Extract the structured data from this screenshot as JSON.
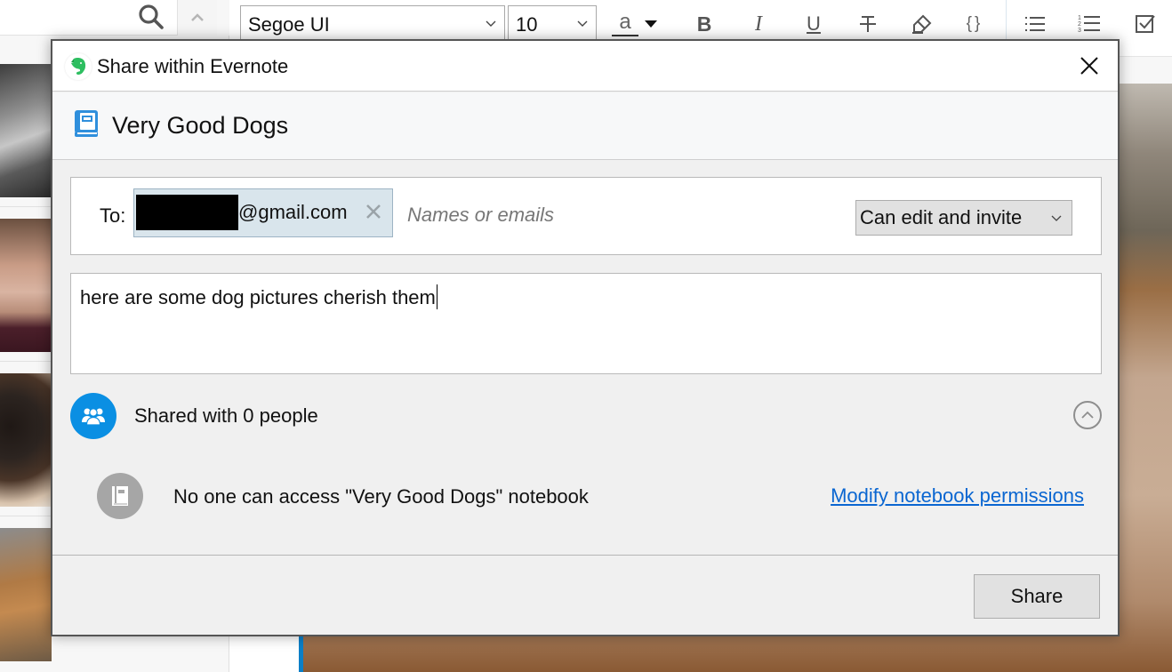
{
  "background_app": {
    "toolbar": {
      "font_family_value": "Segoe UI",
      "font_size_value": "10",
      "buttons": [
        {
          "name": "font-color",
          "glyph": "a"
        },
        {
          "name": "font-color-dropdown",
          "glyph": "▼"
        },
        {
          "name": "bold",
          "glyph": "B"
        },
        {
          "name": "italic",
          "glyph": "I"
        },
        {
          "name": "underline",
          "glyph": "U"
        },
        {
          "name": "strikethrough",
          "glyph": "T"
        },
        {
          "name": "highlight",
          "glyph": "highlighter"
        },
        {
          "name": "code-block",
          "glyph": "{ }"
        },
        {
          "name": "bulleted-list",
          "glyph": "bullet-list"
        },
        {
          "name": "numbered-list",
          "glyph": "numbered-list"
        },
        {
          "name": "checklist",
          "glyph": "checkbox"
        }
      ]
    },
    "accent_color": "#0a7fc7"
  },
  "dialog": {
    "title": "Share within Evernote",
    "notebook_name": "Very Good Dogs",
    "to_label": "To:",
    "recipient": {
      "email_visible_part": "@gmail.com",
      "redacted": true
    },
    "to_input_placeholder": "Names or emails",
    "permission": {
      "selected": "Can edit and invite"
    },
    "message": "here are some dog pictures cherish them",
    "shared_with_text": "Shared with 0 people",
    "access_text": "No one can access \"Very Good Dogs\" notebook",
    "modify_link": "Modify notebook permissions",
    "share_button": "Share",
    "colors": {
      "logo_green": "#2dbe60",
      "notebook_blue": "#2f8fdc",
      "shared_avatar_blue": "#0a8fe3",
      "link_blue": "#0a66d1",
      "access_icon_gray": "#a6a6a6"
    }
  }
}
